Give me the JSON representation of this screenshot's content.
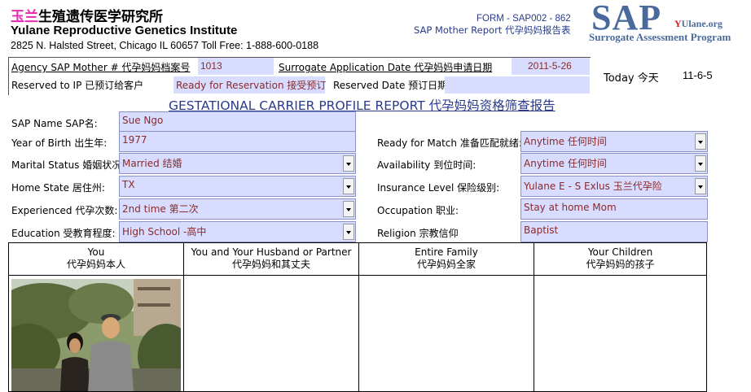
{
  "header": {
    "institute_cn_prefix": "玉兰",
    "institute_cn_rest": "生殖遗传医学研究所",
    "institute_en": "Yulane Reproductive Genetics Institute",
    "address": "2825 N. Halsted Street, Chicago IL 60657  Toll Free: 1-888-600-0188",
    "form_number": "FORM - SAP002 - 862",
    "form_title": "SAP Mother Report 代孕妈妈报告表",
    "logo_text": "SAP",
    "logo_url_y": "Y",
    "logo_url_rest": "Ulane.org",
    "logo_subtitle": "Surrogate Assessment Program"
  },
  "top_info": {
    "agency_label": "Agency SAP Mother  # 代孕妈妈档案号",
    "agency_value": "1013",
    "surrogate_label": "Surrogate Application Date 代孕妈妈申请日期",
    "surrogate_date": "2011-5-26",
    "reserved_label": "Reserved to IP  已预订给客户",
    "ready_reservation": "Ready for Reservation 接受预订",
    "reserved_date_label": "Reserved Date 预订日期",
    "today_label": "Today 今天",
    "today_value": "11-6-5"
  },
  "report_title": "GESTATIONAL CARRIER PROFILE REPORT 代孕妈妈资格筛查报告",
  "fields_left": [
    {
      "label": "SAP Name SAP名:",
      "value": "Sue Ngo",
      "dropdown": false
    },
    {
      "label": "Year of Birth 出生年:",
      "value": "1977",
      "dropdown": false
    },
    {
      "label": "Marital Status 婚姻状况:",
      "value": "Married 结婚",
      "dropdown": true
    },
    {
      "label": "Home State 居住州:",
      "value": "TX",
      "dropdown": true
    },
    {
      "label": "Experienced  代孕次数:",
      "value": "2nd time 第二次",
      "dropdown": true
    },
    {
      "label": "Education 受教育程度:",
      "value": "High School -高中",
      "dropdown": true
    }
  ],
  "fields_right": [
    {
      "label": "Ready for Match 准备匹配就绪:",
      "value": "Anytime 任何时间",
      "dropdown": true
    },
    {
      "label": "Availability 到位时间:",
      "value": "Anytime 任何时间",
      "dropdown": true
    },
    {
      "label": "Insurance Level 保险级别:",
      "value": "Yulane E - S Exlus 玉兰代孕险",
      "dropdown": true
    },
    {
      "label": "Occupation  职业:",
      "value": "Stay at home Mom",
      "dropdown": false
    },
    {
      "label": "Religion 宗教信仰",
      "value": "Baptist",
      "dropdown": false
    }
  ],
  "photo_columns": [
    {
      "en": "You",
      "cn": "代孕妈妈本人"
    },
    {
      "en": "You and Your Husband or Partner",
      "cn": "代孕妈妈和其丈夫"
    },
    {
      "en": "Entire Family",
      "cn": "代孕妈妈全家"
    },
    {
      "en": "Your Children",
      "cn": "代孕妈妈的孩子"
    }
  ],
  "colors": {
    "accent": "#4a6a9c",
    "field_fill": "#d8dcff",
    "value_text": "#8b2a2a",
    "title_blue": "#2a3a8c"
  }
}
